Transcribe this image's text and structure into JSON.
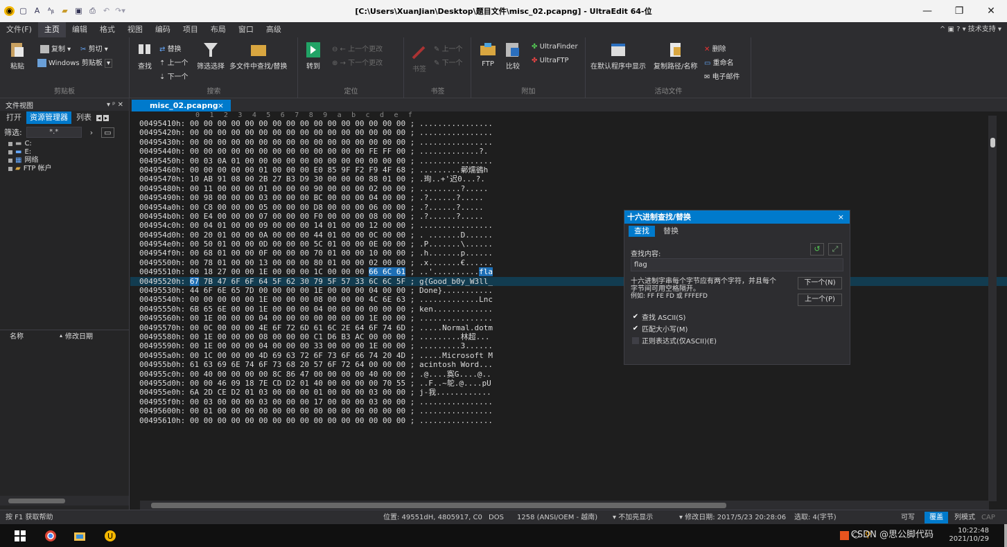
{
  "window": {
    "title": "[C:\\Users\\XuanJian\\Desktop\\题目文件\\misc_02.pcapng] - UltraEdit 64-位",
    "minimize": "—",
    "restore": "❐",
    "close": "✕"
  },
  "menu": {
    "items": [
      "文件(F)",
      "主页",
      "编辑",
      "格式",
      "视图",
      "编码",
      "项目",
      "布局",
      "窗口",
      "高级"
    ],
    "active": "主页",
    "right": "^ ▣ ? ▾ 技术支持 ▾"
  },
  "ribbon": {
    "clipboard": {
      "label": "剪贴板",
      "paste": "粘贴",
      "copy": "复制 ▾",
      "cut": "剪切 ▾",
      "windows_clipboard": "Windows 剪贴板"
    },
    "search": {
      "label": "搜索",
      "find": "查找",
      "replace": "替换",
      "prev": "上一个",
      "next": "下一个",
      "filter": "筛选选择",
      "multi_file": "多文件中查找/替换"
    },
    "goto": {
      "label": "定位",
      "goto": "转到",
      "prev_change": "上一个更改",
      "next_change": "下一个更改"
    },
    "bookmarks": {
      "label": "书签",
      "bookmark": "书签",
      "prev": "上一个",
      "next": "下一个"
    },
    "addons": {
      "label": "附加",
      "ftp": "FTP",
      "compare": "比较",
      "ultrafinder": "UltraFinder",
      "ultraftp": "UltraFTP"
    },
    "active_file": {
      "label": "活动文件",
      "show_default": "在默认程序中显示",
      "copy_path": "复制路径/名称",
      "delete": "删除",
      "rename": "重命名",
      "email": "电子邮件"
    }
  },
  "left_panel": {
    "title": "文件视图",
    "pin": "▾ ᵖ ✕",
    "tabs": [
      "打开",
      "资源管理器",
      "列表"
    ],
    "active_tab": "资源管理器",
    "filter_label": "筛选:",
    "filter_value": "*.*",
    "tree": [
      "C:",
      "E:",
      "网络",
      "FTP 帐户"
    ],
    "columns": [
      "名称",
      "修改日期"
    ]
  },
  "editor": {
    "tab": "misc_02.pcapng",
    "tab_close": "×",
    "ruler": "0  1  2  3  4  5  6  7  8  9  a  b  c  d  e  f",
    "rows": [
      {
        "addr": "00495410h:",
        "hex": "00 00 00 00 00 00 00 00 00 00 00 00 00 00 00 00",
        "ascii": "................"
      },
      {
        "addr": "00495420h:",
        "hex": "00 00 00 00 00 00 00 00 00 00 00 00 00 00 00 00",
        "ascii": "................"
      },
      {
        "addr": "00495430h:",
        "hex": "00 00 00 00 00 00 00 00 00 00 00 00 00 00 00 00",
        "ascii": "................"
      },
      {
        "addr": "00495440h:",
        "hex": "00 00 00 00 00 00 00 00 00 00 00 00 00 FE FF 00",
        "ascii": ".............?."
      },
      {
        "addr": "00495450h:",
        "hex": "00 03 0A 01 00 00 00 00 00 00 00 00 00 00 00 00",
        "ascii": "................"
      },
      {
        "addr": "00495460h:",
        "hex": "00 00 00 00 00 01 00 00 00 E0 85 9F F2 F9 4F 68",
        "ascii": ".........鄵燸鵒h"
      },
      {
        "addr": "00495470h:",
        "hex": "10 AB 91 08 00 2B 27 B3 D9 30 00 00 00 88 01 00",
        "ascii": ".珣..+'迟0...?."
      },
      {
        "addr": "00495480h:",
        "hex": "00 11 00 00 00 01 00 00 00 90 00 00 00 02 00 00",
        "ascii": ".........?....."
      },
      {
        "addr": "00495490h:",
        "hex": "00 98 00 00 00 03 00 00 00 BC 00 00 00 04 00 00",
        "ascii": ".?......?....."
      },
      {
        "addr": "004954a0h:",
        "hex": "00 C8 00 00 00 05 00 00 00 D8 00 00 00 06 00 00",
        "ascii": ".?......?....."
      },
      {
        "addr": "004954b0h:",
        "hex": "00 E4 00 00 00 07 00 00 00 F0 00 00 00 08 00 00",
        "ascii": ".?......?....."
      },
      {
        "addr": "004954c0h:",
        "hex": "00 04 01 00 00 09 00 00 00 14 01 00 00 12 00 00",
        "ascii": "................"
      },
      {
        "addr": "004954d0h:",
        "hex": "00 20 01 00 00 0A 00 00 00 44 01 00 00 0C 00 00",
        "ascii": ". .......D......"
      },
      {
        "addr": "004954e0h:",
        "hex": "00 50 01 00 00 0D 00 00 00 5C 01 00 00 0E 00 00",
        "ascii": ".P.......\\......"
      },
      {
        "addr": "004954f0h:",
        "hex": "00 68 01 00 00 0F 00 00 00 70 01 00 00 10 00 00",
        "ascii": ".h.......p......"
      },
      {
        "addr": "00495500h:",
        "hex": "00 78 01 00 00 13 00 00 00 80 01 00 00 02 00 00",
        "ascii": ".x.......€......"
      },
      {
        "addr": "00495510h:",
        "hex": "00 18 27 00 00 1E 00 00 00 1C 00 00 00 66 6C 61",
        "ascii": "..'..........fla"
      },
      {
        "addr": "00495520h:",
        "hex": "67 7B 47 6F 6F 64 5F 62 30 79 5F 57 33 6C 6C 5F",
        "ascii": "g{Good_b0y_W3ll_"
      },
      {
        "addr": "00495530h:",
        "hex": "44 6F 6E 65 7D 00 00 00 00 1E 00 00 00 04 00 00",
        "ascii": "Done}..........."
      },
      {
        "addr": "00495540h:",
        "hex": "00 00 00 00 00 1E 00 00 00 08 00 00 00 4C 6E 63",
        "ascii": ".............Lnc"
      },
      {
        "addr": "00495550h:",
        "hex": "6B 65 6E 00 00 1E 00 00 00 04 00 00 00 00 00 00",
        "ascii": "ken............."
      },
      {
        "addr": "00495560h:",
        "hex": "00 1E 00 00 00 04 00 00 00 00 00 00 00 1E 00 00",
        "ascii": "................"
      },
      {
        "addr": "00495570h:",
        "hex": "00 0C 00 00 00 4E 6F 72 6D 61 6C 2E 64 6F 74 6D",
        "ascii": ".....Normal.dotm"
      },
      {
        "addr": "00495580h:",
        "hex": "00 1E 00 00 00 08 00 00 00 C1 D6 B3 AC 00 00 00",
        "ascii": ".........林超..."
      },
      {
        "addr": "00495590h:",
        "hex": "00 1E 00 00 00 04 00 00 00 33 00 00 00 1E 00 00",
        "ascii": ".........3......"
      },
      {
        "addr": "004955a0h:",
        "hex": "00 1C 00 00 00 4D 69 63 72 6F 73 6F 66 74 20 4D",
        "ascii": ".....Microsoft M"
      },
      {
        "addr": "004955b0h:",
        "hex": "61 63 69 6E 74 6F 73 68 20 57 6F 72 64 00 00 00",
        "ascii": "acintosh Word..."
      },
      {
        "addr": "004955c0h:",
        "hex": "00 40 00 00 00 00 8C 86 47 00 00 00 00 40 00 00",
        "ascii": ".@....寏G....@.."
      },
      {
        "addr": "004955d0h:",
        "hex": "00 00 46 09 18 7E CD D2 01 40 00 00 00 00 70 55",
        "ascii": "..F..~鸵.@....pU"
      },
      {
        "addr": "004955e0h:",
        "hex": "6A 2D CE D2 01 03 00 00 00 01 00 00 00 03 00 00",
        "ascii": "j-我............"
      },
      {
        "addr": "004955f0h:",
        "hex": "00 03 00 00 00 03 00 00 00 17 00 00 00 03 00 00",
        "ascii": "................"
      },
      {
        "addr": "00495600h:",
        "hex": "00 01 00 00 00 00 00 00 00 00 00 00 00 00 00 00",
        "ascii": "................"
      },
      {
        "addr": "00495610h:",
        "hex": "00 00 00 00 00 00 00 00 00 00 00 00 00 00 00 00",
        "ascii": "................"
      }
    ]
  },
  "dialog": {
    "title": "十六进制查找/替换",
    "close": "×",
    "tabs": [
      "查找",
      "替换"
    ],
    "active_tab": "查找",
    "find_label": "查找内容:",
    "find_value": "flag",
    "hint1": "十六进制字串每个字节应有两个字符，并且每个",
    "hint2": "字节间可用空格隔开。",
    "hint3": "例如: FF FE FD 或 FFFEFD",
    "next_btn": "下一个(N)",
    "prev_btn": "上一个(P)",
    "options": [
      {
        "label": "查找 ASCII(S)",
        "checked": true
      },
      {
        "label": "匹配大小写(M)",
        "checked": true
      },
      {
        "label": "正则表达式(仅ASCII)(E)",
        "checked": false
      }
    ]
  },
  "status": {
    "help": "按 F1 获取帮助",
    "position": "位置: 49551dH, 4805917, C0",
    "line_ending": "DOS",
    "encoding": "1258  (ANSI/OEM - 越南)",
    "highlight": "▾ 不加亮显示",
    "modified": "▾ 修改日期: 2017/5/23 20:28:06",
    "selection": "选取: 4(字节)",
    "mode_rw": "可写",
    "mode_ins": "覆盖",
    "mode_col": "列模式",
    "caps": "CAP"
  },
  "taskbar": {
    "tray_text": "CSDN @思公脚代码",
    "time": "10:22:48",
    "date": "2021/10/29"
  },
  "colors": {
    "accent": "#007acc",
    "highlight": "#1e6fb5",
    "bg": "#1e1e1e",
    "panel": "#2d2d30"
  }
}
